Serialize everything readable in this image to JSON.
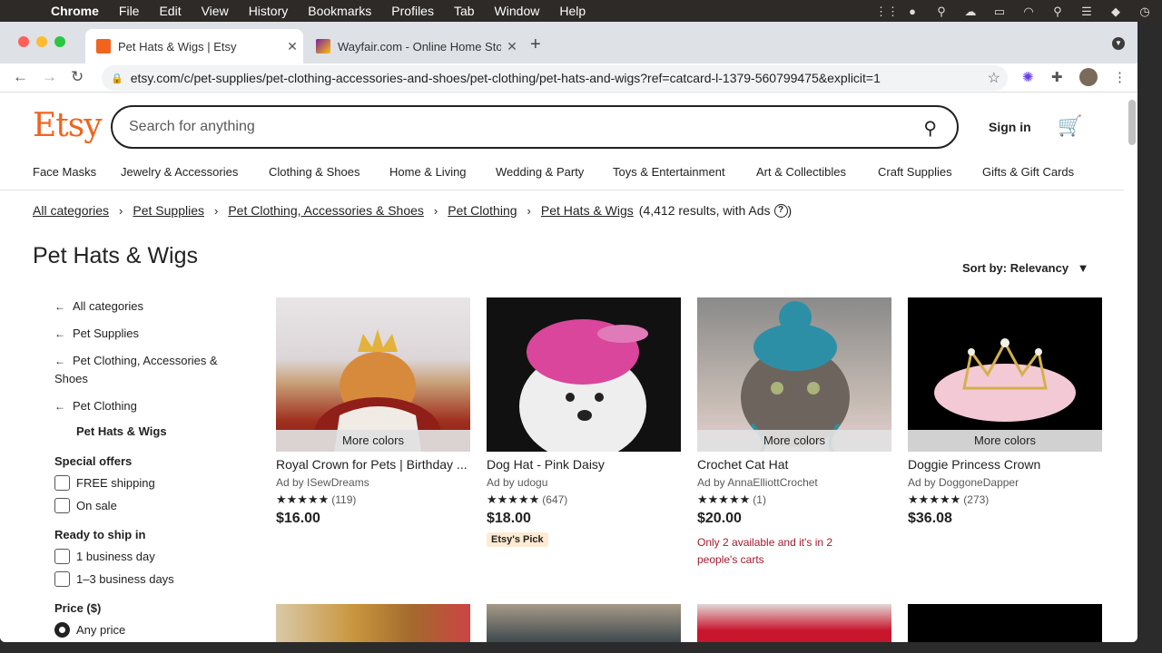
{
  "menubar": {
    "app": "Chrome",
    "items": [
      "File",
      "Edit",
      "View",
      "History",
      "Bookmarks",
      "Profiles",
      "Tab",
      "Window",
      "Help"
    ]
  },
  "browser": {
    "tabs": [
      {
        "title": "Pet Hats & Wigs | Etsy",
        "active": true
      },
      {
        "title": "Wayfair.com - Online Home Sto",
        "active": false
      }
    ],
    "url": "etsy.com/c/pet-supplies/pet-clothing-accessories-and-shoes/pet-clothing/pet-hats-and-wigs?ref=catcard-l-1379-560799475&explicit=1"
  },
  "header": {
    "logo": "Etsy",
    "search_placeholder": "Search for anything",
    "signin": "Sign in"
  },
  "catnav": [
    "Face Masks",
    "Jewelry & Accessories",
    "Clothing & Shoes",
    "Home & Living",
    "Wedding & Party",
    "Toys & Entertainment",
    "Art & Collectibles",
    "Craft Supplies",
    "Gifts & Gift Cards"
  ],
  "breadcrumb": {
    "items": [
      "All categories",
      "Pet Supplies",
      "Pet Clothing, Accessories & Shoes",
      "Pet Clothing",
      "Pet Hats & Wigs"
    ],
    "count": "(4,412 results, with Ads"
  },
  "page_title": "Pet Hats & Wigs",
  "sort_label": "Sort by: Relevancy",
  "sidebar": {
    "back_links": [
      "All categories",
      "Pet Supplies",
      "Pet Clothing, Accessories & Shoes",
      "Pet Clothing"
    ],
    "current": "Pet Hats & Wigs",
    "special_offers": {
      "title": "Special offers",
      "options": [
        "FREE shipping",
        "On sale"
      ]
    },
    "ready_to_ship": {
      "title": "Ready to ship in",
      "options": [
        "1 business day",
        "1–3 business days"
      ]
    },
    "price": {
      "title": "Price ($)",
      "selected": "Any price"
    }
  },
  "products": [
    {
      "title": "Royal Crown for Pets | Birthday ...",
      "shop": "Ad by ISewDreams",
      "rating": "★★★★★",
      "reviews": "(119)",
      "price": "$16.00",
      "more_colors": "More colors"
    },
    {
      "title": "Dog Hat - Pink Daisy",
      "shop": "Ad by udogu",
      "rating": "★★★★★",
      "reviews": "(647)",
      "price": "$18.00",
      "badge": "Etsy's Pick"
    },
    {
      "title": "Crochet Cat Hat",
      "shop": "Ad by AnnaElliottCrochet",
      "rating": "★★★★★",
      "reviews": "(1)",
      "price": "$20.00",
      "more_colors": "More colors",
      "warning": "Only 2 available and it's in 2 people's carts"
    },
    {
      "title": "Doggie Princess Crown",
      "shop": "Ad by DoggoneDapper",
      "rating": "★★★★★",
      "reviews": "(273)",
      "price": "$36.08",
      "more_colors": "More colors"
    }
  ],
  "colors": {
    "etsy_orange": "#f1641e",
    "warning_red": "#a61a2e",
    "pick_badge": "#fdebd2"
  }
}
